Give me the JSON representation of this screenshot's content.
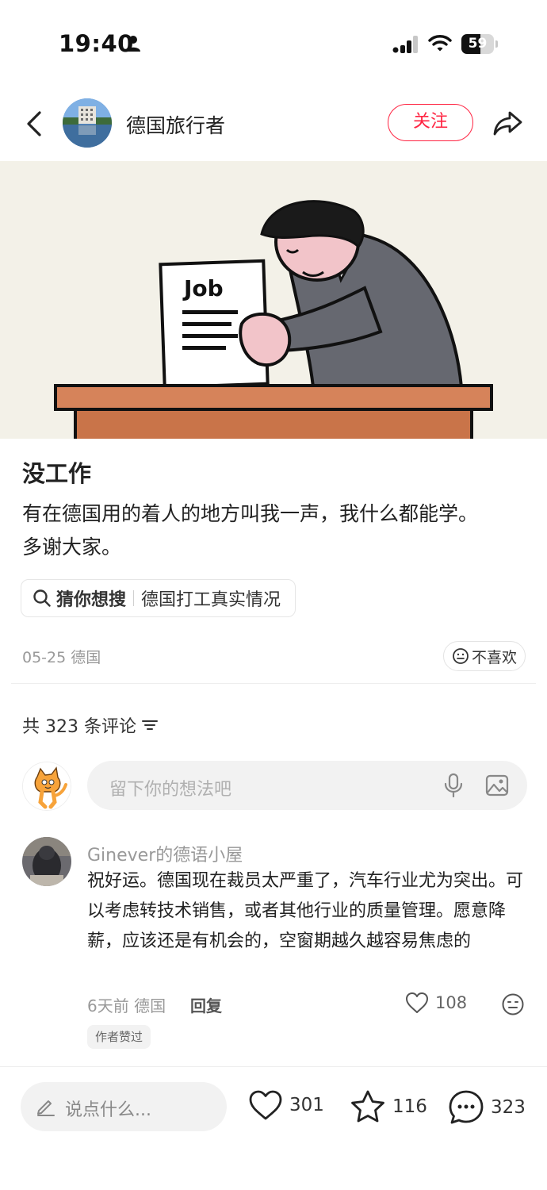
{
  "status_bar": {
    "time": "19:40",
    "battery": "59",
    "battery_level": 0.59
  },
  "header": {
    "author_name": "德国旅行者",
    "follow_label": "关注"
  },
  "post": {
    "image_text": "Job",
    "title": "没工作",
    "body_line1": "有在德国用的着人的地方叫我一声，我什么都能学。",
    "body_line2": "多谢大家。",
    "search_chip_prefix": "猜你想搜",
    "search_chip_text": "德国打工真实情况",
    "date_location": "05-25 德国",
    "dislike_label": "不喜欢"
  },
  "comments_section": {
    "count_label": "共 323 条评论",
    "input_placeholder": "留下你的想法吧"
  },
  "comments": [
    {
      "username": "Ginever的德语小屋",
      "text": "祝好运。德国现在裁员太严重了，汽车行业尤为突出。可以考虑转技术销售，或者其他行业的质量管理。愿意降薪，应该还是有机会的，空窗期越久越容易焦虑的",
      "meta": "6天前 德国",
      "reply_label": "回复",
      "likes": "108",
      "badge": "作者赞过"
    }
  ],
  "bottom_bar": {
    "input_placeholder": "说点什么...",
    "likes": "301",
    "favorites": "116",
    "comments": "323"
  },
  "colors": {
    "accent": "#ff2442",
    "muted_text": "#999999",
    "input_bg": "#f2f2f2"
  }
}
